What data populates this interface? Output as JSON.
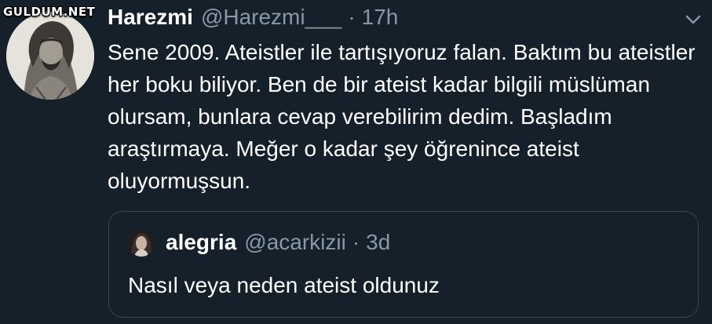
{
  "watermark": {
    "text": "GULDUM.NET"
  },
  "tweet": {
    "author_name": "Harezmi",
    "author_handle": "@Harezmi___",
    "separator": "·",
    "timestamp": "17h",
    "text": "Sene 2009. Ateistler ile tartışıyoruz falan. Baktım bu ateistler her boku biliyor. Ben de bir ateist kadar bilgili müslüman olursam, bunlara cevap verebilirim dedim. Başladım araştırmaya. Meğer o kadar şey öğrenince ateist oluyormuşsun.",
    "avatar_icon": "engraved-portrait-avatar",
    "menu_icon": "chevron-down-icon"
  },
  "quoted_tweet": {
    "author_name": "alegria",
    "author_handle": "@acarkizii",
    "separator": "·",
    "timestamp": "3d",
    "text": "Nasıl veya neden ateist oldunuz",
    "avatar_icon": "user-photo-avatar"
  },
  "colors": {
    "background": "#15202b",
    "primary_text": "#ffffff",
    "secondary_text": "#8899a6",
    "border": "#38444d"
  }
}
